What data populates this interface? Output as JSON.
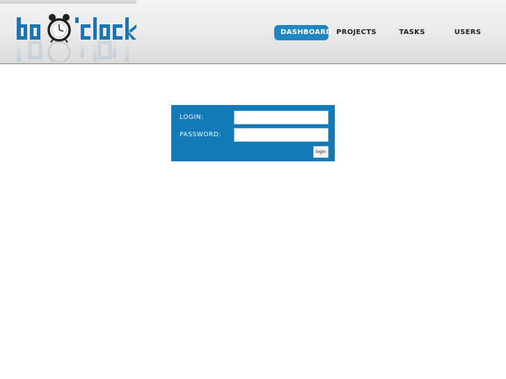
{
  "header": {
    "logo_text": "do o'clock"
  },
  "nav": {
    "items": [
      {
        "label": "DASHBOARD",
        "active": true
      },
      {
        "label": "PROJECTS",
        "active": false
      },
      {
        "label": "TASKS",
        "active": false
      },
      {
        "label": "USERS",
        "active": false
      }
    ]
  },
  "login_form": {
    "login_label": "LOGIN:",
    "login_value": "",
    "password_label": "PASSWORD:",
    "password_value": "",
    "submit_label": "login"
  },
  "colors": {
    "accent": "#1e86c2",
    "panel": "#127bb7",
    "logo": "#1976b5"
  },
  "icons": {
    "logo_clock": "alarm-clock-icon"
  }
}
